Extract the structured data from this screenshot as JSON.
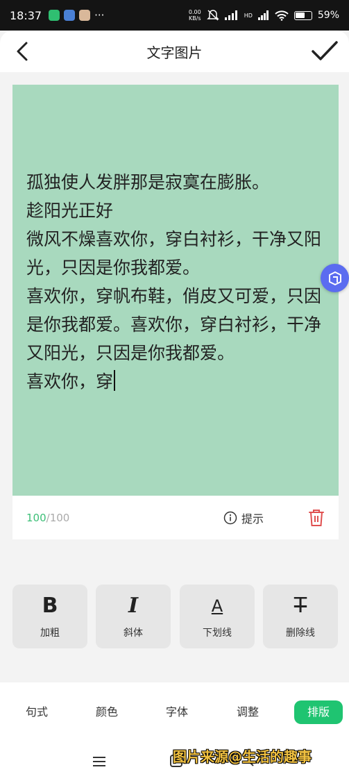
{
  "status_bar": {
    "time": "18:37",
    "more": "···",
    "net_speed": "0.00",
    "net_unit": "KB/s",
    "hd": "HD",
    "battery": "59%",
    "battery_level": 0.59
  },
  "header": {
    "title": "文字图片"
  },
  "editor": {
    "text": "孤独使人发胖那是寂寞在膨胀。\n趁阳光正好\n微风不燥喜欢你，穿白衬衫，干净又阳光，只因是你我都爱。\n喜欢你，穿帆布鞋，俏皮又可爱，只因是你我都爱。喜欢你，穿白衬衫，干净又阳光，只因是你我都爱。\n喜欢你，穿",
    "background_color": "#a8d9be",
    "counter_current": "100",
    "counter_max": "/100",
    "hint_label": "提示"
  },
  "format_buttons": [
    {
      "glyph": "B",
      "label": "加粗"
    },
    {
      "glyph": "I",
      "label": "斜体"
    },
    {
      "glyph": "A",
      "label": "下划线"
    },
    {
      "glyph": "T",
      "label": "删除线"
    }
  ],
  "tabs": [
    {
      "label": "句式"
    },
    {
      "label": "颜色"
    },
    {
      "label": "字体"
    },
    {
      "label": "调整"
    },
    {
      "label": "排版",
      "active": true
    }
  ],
  "watermark": "图片来源@生活的趣事",
  "colors": {
    "accent": "#1fc471",
    "counter": "#3cbf77",
    "delete": "#e05050",
    "badge": "#5b6cf0"
  }
}
